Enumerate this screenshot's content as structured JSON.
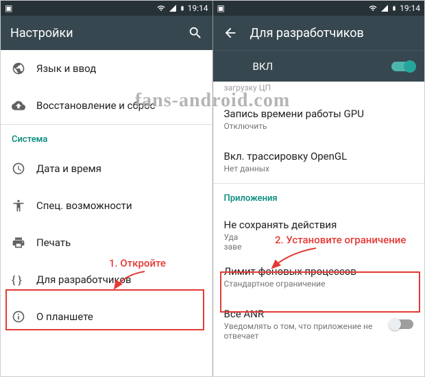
{
  "status": {
    "time": "19:14"
  },
  "left": {
    "title": "Настройки",
    "rows": {
      "lang": "Язык и ввод",
      "backup": "Восстановление и сброс"
    },
    "section_system": "Система",
    "system_rows": {
      "datetime": "Дата и время",
      "accessibility": "Спец. возможности",
      "print": "Печать",
      "dev": "Для разработчиков",
      "about": "О планшете"
    }
  },
  "right": {
    "title": "Для разработчиков",
    "toggle_label": "ВКЛ",
    "cpu_clip": "загрузку ЦП",
    "gpu_time": {
      "primary": "Запись времени работы GPU",
      "secondary": "Отключить"
    },
    "opengl": {
      "primary": "Вкл. трассировку OpenGL",
      "secondary": "Нет данных"
    },
    "section_apps": "Приложения",
    "no_keep": {
      "primary": "Не сохранять действия",
      "secondary_clip": "Уда\nзаве"
    },
    "bg_limit": {
      "primary": "Лимит фоновых процессов",
      "secondary": "Стандартное ограничение"
    },
    "anr": {
      "primary": "Все ANR",
      "secondary": "Уведомлять о том, что приложение не отвечает"
    }
  },
  "annotations": {
    "step1": "1. Откройте",
    "step2": "2. Установите ограничение",
    "watermark": "fans-android.com"
  }
}
